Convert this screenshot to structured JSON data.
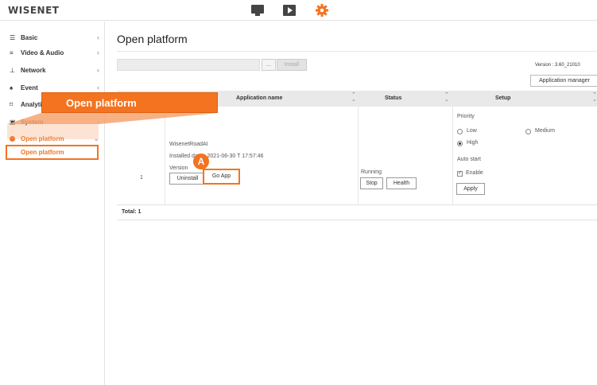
{
  "header": {
    "logo_text": "WISENET",
    "icons": [
      "monitor-icon",
      "play-icon",
      "gear-icon"
    ],
    "accent_color": "#f37321"
  },
  "sidebar": {
    "items": [
      {
        "label": "Basic",
        "icon": "list-icon"
      },
      {
        "label": "Video & Audio",
        "icon": "lines-icon"
      },
      {
        "label": "Network",
        "icon": "network-icon"
      },
      {
        "label": "Event",
        "icon": "bell-icon"
      },
      {
        "label": "Analytics",
        "icon": "frame-icon"
      },
      {
        "label": "System",
        "icon": "system-icon"
      },
      {
        "label": "Open platform",
        "icon": "dot-icon",
        "active": true
      }
    ],
    "sub_item": "Open platform",
    "chevron": "‹",
    "chevron_open": "⌄"
  },
  "main": {
    "title": "Open platform",
    "browse_label": "...",
    "install_label": "Install",
    "version_text": "Version : 3.60_21010",
    "app_manager_label": "Application manager",
    "table": {
      "headers": [
        "Application name",
        "Status",
        "Setup"
      ],
      "row": {
        "index": "1",
        "app_name": "WisenetRoadAI",
        "installed_date": "Installed date : 2021-06-30 T 17:57:46",
        "version_label": "Version",
        "uninstall_label": "Uninstall",
        "goapp_label": "Go App",
        "status": "Running",
        "stop_label": "Stop",
        "health_label": "Health",
        "priority_label": "Priority",
        "priority_options": [
          "Low",
          "Medium",
          "High"
        ],
        "priority_selected": "High",
        "auto_start_label": "Auto start",
        "enable_label": "Enable",
        "enable_checked": true,
        "apply_label": "Apply"
      },
      "total": "Total: 1"
    }
  },
  "callout": {
    "label": "Open platform",
    "marker": "A"
  }
}
